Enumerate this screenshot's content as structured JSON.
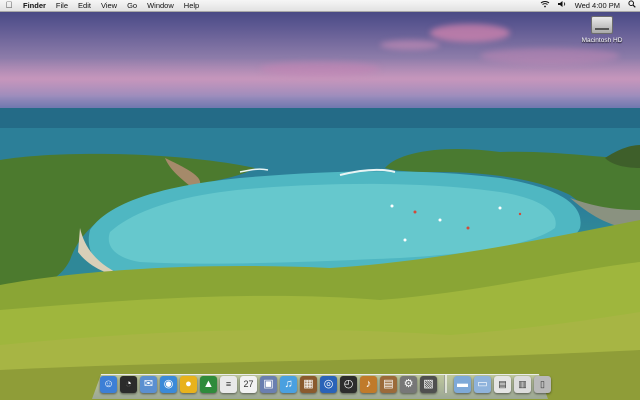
{
  "menubar": {
    "apple_icon": "apple-logo-icon",
    "app_name": "Finder",
    "menus": [
      "File",
      "Edit",
      "View",
      "Go",
      "Window",
      "Help"
    ],
    "status": {
      "wifi_icon": "wifi-icon",
      "volume_icon": "volume-icon",
      "clock": "Wed 4:00 PM",
      "spotlight_icon": "spotlight-search-icon"
    }
  },
  "desktop": {
    "icons": [
      {
        "label": "Macintosh HD",
        "icon": "hard-drive-icon"
      }
    ]
  },
  "dock": {
    "apps": [
      {
        "icon": "finder-icon",
        "color": "#3d7fd6",
        "glyph": "☺"
      },
      {
        "icon": "dashboard-icon",
        "color": "#2b2b2b",
        "glyph": "◔"
      },
      {
        "icon": "mail-icon",
        "color": "#5b8fd0",
        "glyph": "✉"
      },
      {
        "icon": "safari-icon",
        "color": "#3b8ad8",
        "glyph": "◉"
      },
      {
        "icon": "ichat-icon",
        "color": "#e8b21c",
        "glyph": "●"
      },
      {
        "icon": "address-book-icon",
        "color": "#2f8b3b",
        "glyph": "▲"
      },
      {
        "icon": "textedit-icon",
        "color": "#e9e9e9",
        "glyph": "≡"
      },
      {
        "icon": "ical-icon",
        "color": "#f2f2f2",
        "glyph": "27"
      },
      {
        "icon": "preview-icon",
        "color": "#6a7fb0",
        "glyph": "▣"
      },
      {
        "icon": "itunes-icon",
        "color": "#4aa0e0",
        "glyph": "♫"
      },
      {
        "icon": "iphoto-icon",
        "color": "#8a5a2e",
        "glyph": "▦"
      },
      {
        "icon": "dvd-player-icon",
        "color": "#2a63b8",
        "glyph": "◎"
      },
      {
        "icon": "time-machine-icon",
        "color": "#2c2c2c",
        "glyph": "◴"
      },
      {
        "icon": "garageband-icon",
        "color": "#c07a2a",
        "glyph": "♪"
      },
      {
        "icon": "photo-booth-icon",
        "color": "#9b6a3a",
        "glyph": "▤"
      },
      {
        "icon": "system-preferences-icon",
        "color": "#777777",
        "glyph": "⚙"
      },
      {
        "icon": "activity-monitor-icon",
        "color": "#4f4f4f",
        "glyph": "▧"
      }
    ],
    "stacks": [
      {
        "icon": "applications-folder-icon",
        "color": "#7ea9d8",
        "glyph": "▬"
      },
      {
        "icon": "documents-folder-icon",
        "color": "#8fb3dc",
        "glyph": "▭"
      },
      {
        "icon": "downloads-stack-icon",
        "color": "#e5e5e5",
        "glyph": "▤"
      },
      {
        "icon": "screenshot-stack-icon",
        "color": "#dcdcdc",
        "glyph": "▥"
      },
      {
        "icon": "trash-icon",
        "color": "#b9b9b9",
        "glyph": "▯"
      }
    ]
  }
}
